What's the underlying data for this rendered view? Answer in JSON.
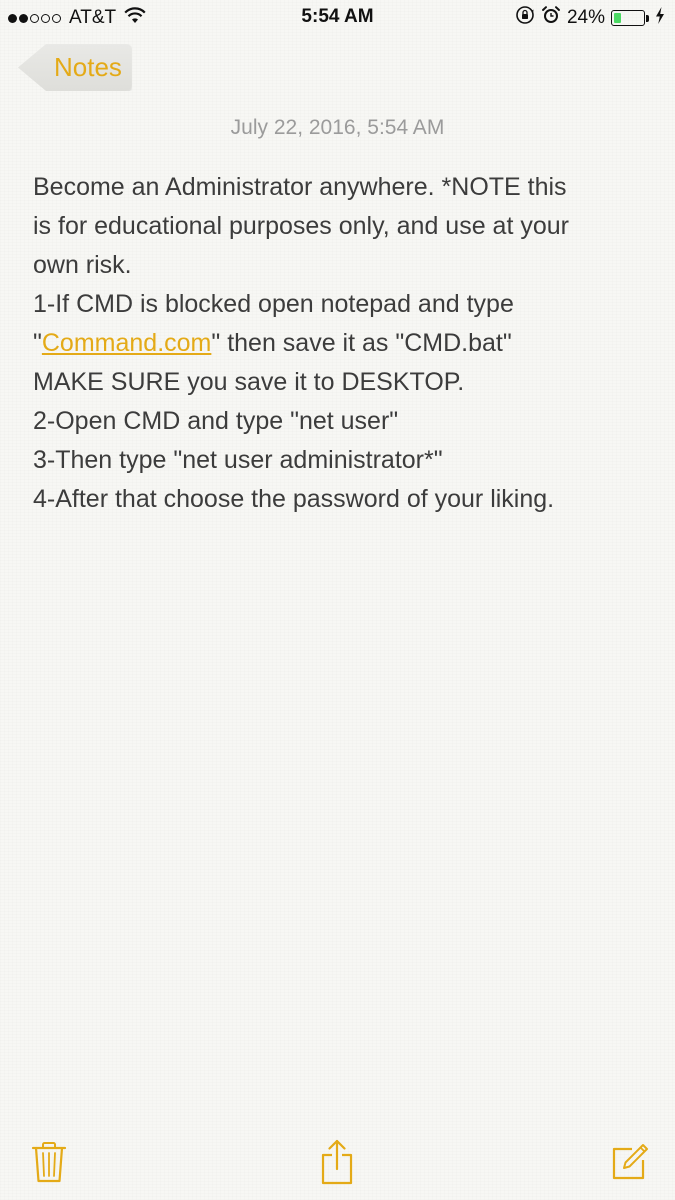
{
  "status_bar": {
    "signal_filled": 2,
    "signal_total": 5,
    "carrier": "AT&T",
    "time": "5:54 AM",
    "battery_percent_label": "24%",
    "battery_level": 0.24,
    "icons": [
      "wifi-icon",
      "rotation-lock-icon",
      "alarm-icon",
      "battery-icon",
      "charging-bolt-icon"
    ]
  },
  "nav": {
    "back_label": "Notes"
  },
  "note": {
    "date": "July 22, 2016, 5:54 AM",
    "lines": {
      "l1": "Become an Administrator anywhere. *NOTE this",
      "l2": "is for educational purposes only, and use at your",
      "l3": "own risk.",
      "l4": "1-If CMD is blocked open notepad and type",
      "l5_pre": "\"",
      "l5_link": "Command.com",
      "l5_post": "\" then save it as \"CMD.bat\"",
      "l6": "MAKE SURE you save it to DESKTOP.",
      "l7": "2-Open CMD and type \"net user\"",
      "l8": "3-Then type \"net user administrator*\"",
      "l9": "4-After that choose the password of your liking."
    }
  },
  "toolbar": {
    "icons": [
      "trash-icon",
      "share-icon",
      "compose-icon"
    ]
  },
  "colors": {
    "accent": "#e4aa17",
    "background": "#f7f7f4",
    "text": "#3c3c3c",
    "date_text": "#9b9b9b",
    "battery_fill": "#4cd964"
  }
}
